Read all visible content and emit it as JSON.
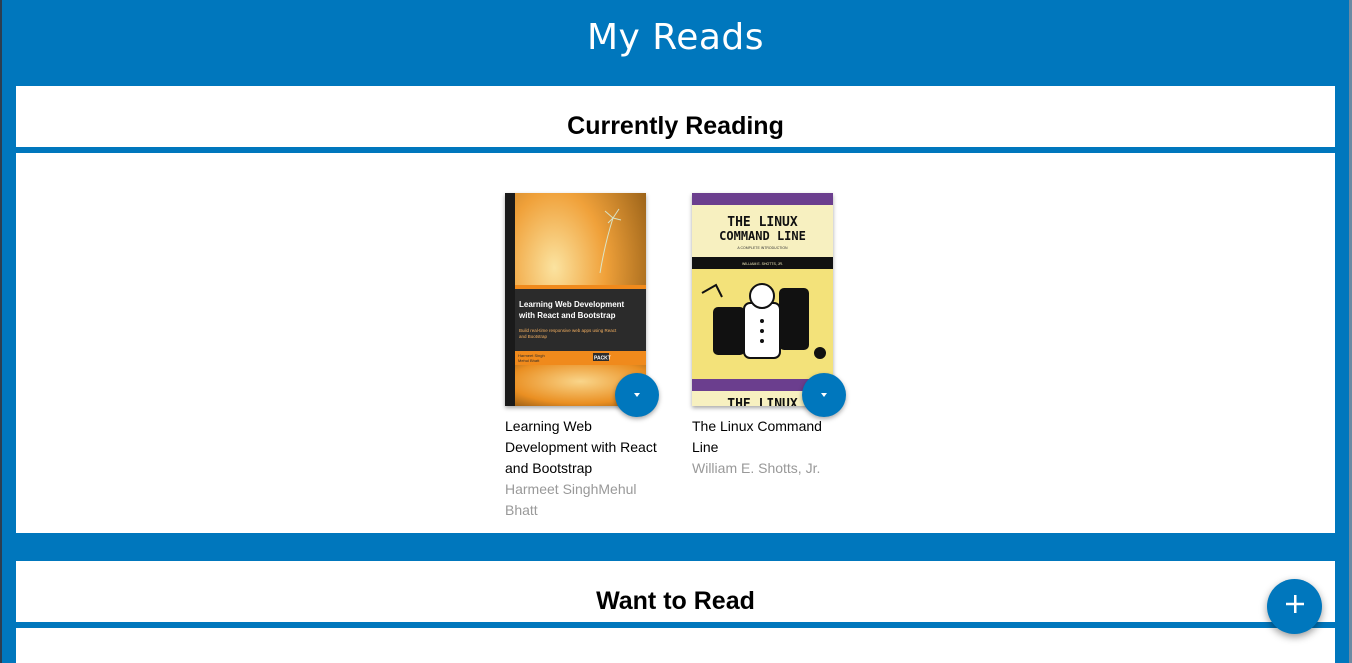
{
  "app": {
    "title": "My Reads"
  },
  "shelves": [
    {
      "title": "Currently Reading",
      "books": [
        {
          "title": "Learning Web Development with React and Bootstrap",
          "authors": "Harmeet SinghMehul Bhatt",
          "cover": {
            "banner_text": "Learning Web Development with React and Bootstrap",
            "subtitle_text": "Build real-time responsive web apps using React and Bootstrap",
            "authors_text": "Harmeet Singh\nMehul Bhatt",
            "publisher_text": "PACKT",
            "colors": {
              "spine": "#1a1a1a",
              "orange": "#f08a1c",
              "dark": "#2b2b2b",
              "sky": "#e5a24c"
            }
          }
        },
        {
          "title": "The Linux Command Line",
          "authors": "William E. Shotts, Jr.",
          "cover": {
            "title_line1": "THE LINUX",
            "title_line2": "COMMAND LINE",
            "tagline": "A COMPLETE INTRODUCTION",
            "author_text": "WILLIAM E. SHOTTS, JR.",
            "bottom_text": "THE LINUX",
            "colors": {
              "purple": "#6b3e8e",
              "cream": "#f7f0c0",
              "yellow": "#f3e27a"
            }
          }
        }
      ]
    },
    {
      "title": "Want to Read",
      "books": []
    }
  ],
  "icons": {
    "shelf_changer": "triangle-down-icon",
    "add": "plus-icon"
  },
  "colors": {
    "primary": "#0077bd",
    "panel": "#ffffff",
    "author_text": "#999999"
  }
}
